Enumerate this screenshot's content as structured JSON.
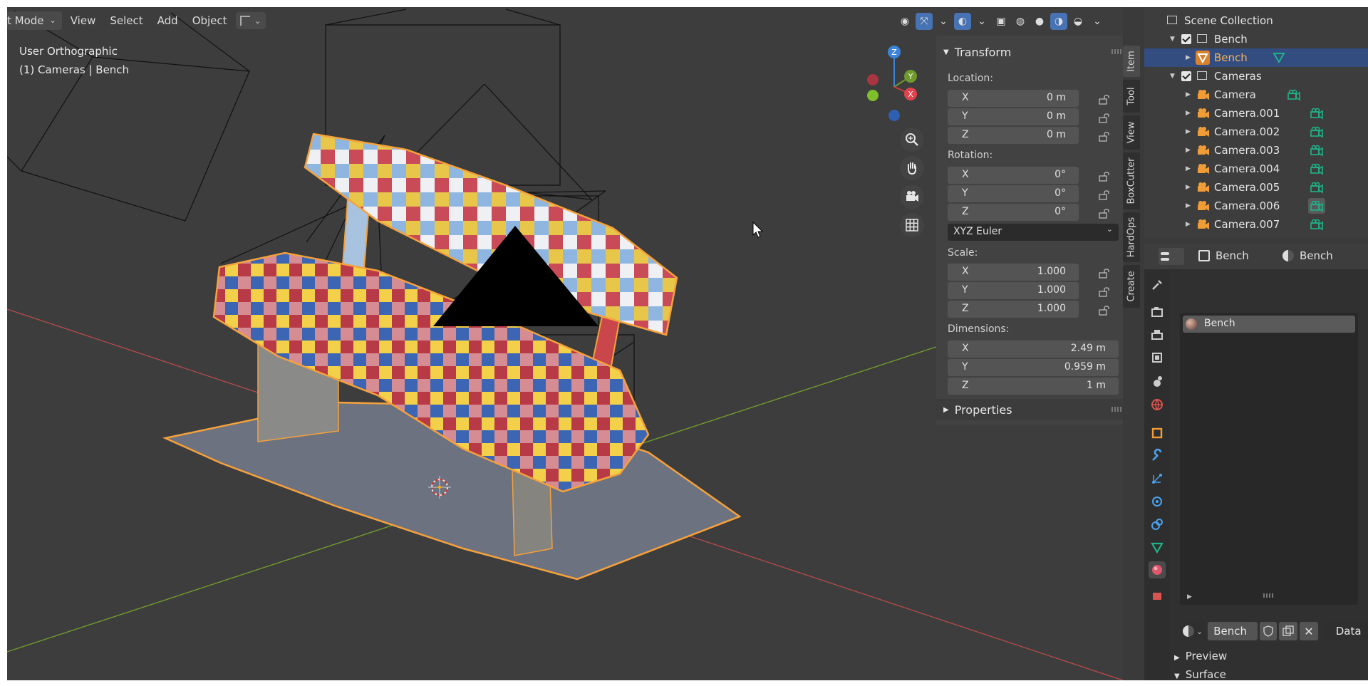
{
  "viewport": {
    "mode_label": "t Mode",
    "menus": [
      "View",
      "Select",
      "Add",
      "Object"
    ],
    "view_name": "User Orthographic",
    "collection_info": "(1) Cameras | Bench",
    "gizmo_labels": {
      "z": "Z",
      "y": "Y",
      "x": "X"
    }
  },
  "npanel": {
    "transform_title": "Transform",
    "location_label": "Location:",
    "location": [
      {
        "axis": "X",
        "value": "0 m"
      },
      {
        "axis": "Y",
        "value": "0 m"
      },
      {
        "axis": "Z",
        "value": "0 m"
      }
    ],
    "rotation_label": "Rotation:",
    "rotation": [
      {
        "axis": "X",
        "value": "0°"
      },
      {
        "axis": "Y",
        "value": "0°"
      },
      {
        "axis": "Z",
        "value": "0°"
      }
    ],
    "rotation_mode": "XYZ Euler",
    "scale_label": "Scale:",
    "scale": [
      {
        "axis": "X",
        "value": "1.000"
      },
      {
        "axis": "Y",
        "value": "1.000"
      },
      {
        "axis": "Z",
        "value": "1.000"
      }
    ],
    "dimensions_label": "Dimensions:",
    "dimensions": [
      {
        "axis": "X",
        "value": "2.49 m"
      },
      {
        "axis": "Y",
        "value": "0.959 m"
      },
      {
        "axis": "Z",
        "value": "1 m"
      }
    ],
    "properties_title": "Properties",
    "tabs": [
      "Item",
      "Tool",
      "View",
      "BoxCutter",
      "HardOps",
      "Create"
    ]
  },
  "outliner": {
    "root": "Scene Collection",
    "rows": [
      {
        "label": "Bench",
        "kind": "collection",
        "checked": true
      },
      {
        "label": "Bench",
        "kind": "mesh",
        "selected": true
      },
      {
        "label": "Cameras",
        "kind": "collection",
        "checked": true
      },
      {
        "label": "Camera",
        "kind": "camera"
      },
      {
        "label": "Camera.001",
        "kind": "camera"
      },
      {
        "label": "Camera.002",
        "kind": "camera"
      },
      {
        "label": "Camera.003",
        "kind": "camera"
      },
      {
        "label": "Camera.004",
        "kind": "camera"
      },
      {
        "label": "Camera.005",
        "kind": "camera"
      },
      {
        "label": "Camera.006",
        "kind": "camera"
      },
      {
        "label": "Camera.007",
        "kind": "camera"
      }
    ]
  },
  "properties": {
    "breadcrumb_object": "Bench",
    "breadcrumb_material": "Bench",
    "slot_item": "Bench",
    "material_name": "Bench",
    "data_label": "Data",
    "sections": [
      "Preview",
      "Surface"
    ]
  },
  "colors": {
    "accent": "#4772b3",
    "selection_outline": "#f5a13c",
    "axis_x": "#c93b3b",
    "axis_y": "#6f9a2c",
    "camera_icon": "#f29c35",
    "data_icon": "#1fb58a"
  }
}
